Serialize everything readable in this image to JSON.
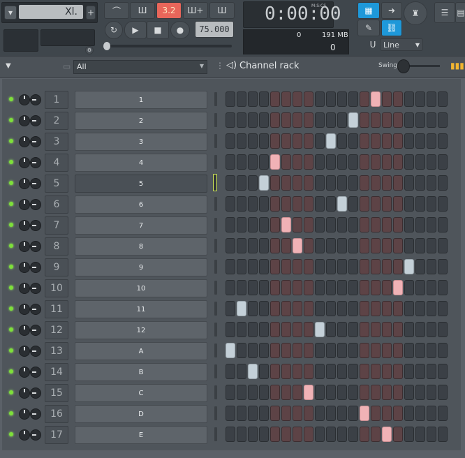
{
  "toolbar": {
    "pattern_name": "Xl.",
    "plus_label": "+",
    "time_display": "0:00:00",
    "time_unit": "M:S:CS",
    "tempo": "75.000",
    "cpu_value": "0",
    "memory": "191 MB",
    "polyphony": "0",
    "snap_mode": "Line",
    "icons": [
      "pattern-menu-icon",
      "typing-keyboard-icon",
      "metronome-icon",
      "record-icon",
      "play-icon",
      "stop-icon",
      "loop-icon",
      "link-icon"
    ],
    "accent": "#0f8fd6"
  },
  "header": {
    "filter": "All",
    "title": "Channel rack",
    "swing_label": "Swing"
  },
  "channels": [
    {
      "num": "1",
      "name": "1",
      "active_step": 13
    },
    {
      "num": "2",
      "name": "2",
      "active_step": 11
    },
    {
      "num": "3",
      "name": "3",
      "active_step": 9
    },
    {
      "num": "4",
      "name": "4",
      "active_step": 4
    },
    {
      "num": "5",
      "name": "5",
      "active_step": 3,
      "selected": true
    },
    {
      "num": "6",
      "name": "6",
      "active_step": 10
    },
    {
      "num": "7",
      "name": "7",
      "active_step": 5
    },
    {
      "num": "8",
      "name": "8",
      "active_step": 6
    },
    {
      "num": "9",
      "name": "9",
      "active_step": 16
    },
    {
      "num": "10",
      "name": "10",
      "active_step": 15
    },
    {
      "num": "11",
      "name": "11",
      "active_step": 1
    },
    {
      "num": "12",
      "name": "12",
      "active_step": 8
    },
    {
      "num": "13",
      "name": "A",
      "active_step": 0
    },
    {
      "num": "14",
      "name": "B",
      "active_step": 2
    },
    {
      "num": "15",
      "name": "C",
      "active_step": 7
    },
    {
      "num": "16",
      "name": "D",
      "active_step": 12
    },
    {
      "num": "17",
      "name": "E",
      "active_step": 14
    }
  ],
  "steps_per_row": 20
}
